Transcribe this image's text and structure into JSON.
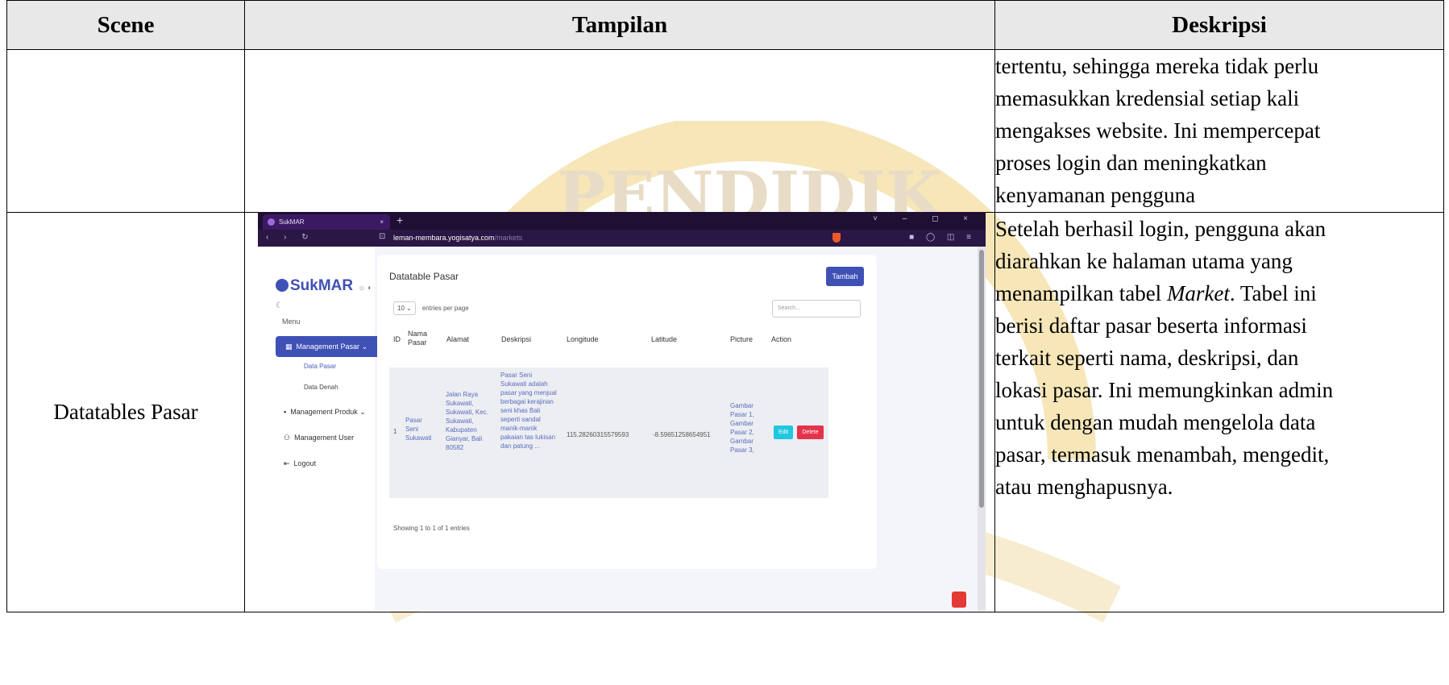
{
  "table": {
    "headers": [
      "Scene",
      "Tampilan",
      "Deskripsi"
    ],
    "row1": {
      "scene": "",
      "description_lines": [
        "tertentu, sehingga mereka tidak perlu",
        "memasukkan kredensial setiap kali",
        "mengakses website. Ini mempercepat",
        "proses login dan meningkatkan",
        "kenyamanan pengguna"
      ]
    },
    "row2": {
      "scene": "Datatables Pasar",
      "description_lines": [
        "Setelah berhasil login, pengguna akan",
        "diarahkan ke halaman utama yang",
        "menampilkan tabel Market. Tabel ini",
        "berisi daftar pasar beserta informasi",
        "terkait seperti nama, deskripsi, dan",
        "lokasi pasar. Ini memungkinkan admin",
        "untuk dengan mudah mengelola data",
        "pasar, termasuk menambah, mengedit,",
        "atau menghapusnya."
      ]
    }
  },
  "screenshot": {
    "tab_title": "SukMAR",
    "url_host": "leman-membara.yogisatya.com",
    "url_path": "/markets",
    "logo": "SukMAR",
    "menu_heading": "Menu",
    "sidebar": {
      "management_pasar": "Management Pasar",
      "data_pasar": "Data Pasar",
      "data_denah": "Data Denah",
      "management_produk": "Management Produk",
      "management_user": "Management User",
      "logout": "Logout"
    },
    "card_title": "Datatable Pasar",
    "add_button": "Tambah",
    "entries_value": "10",
    "entries_label": "entries per page",
    "search_placeholder": "Search...",
    "columns": [
      "ID",
      "Nama Pasar",
      "Alamat",
      "Deskripsi",
      "Longitude",
      "Latitude",
      "Picture",
      "Action"
    ],
    "row": {
      "id": "1",
      "nama": "Pasar Seni Sukawati",
      "alamat": "Jalan Raya Sukawati, Sukawati, Kec. Sukawati, Kabupaten Gianyar, Bali 80582",
      "deskripsi": "Pasar Seni Sukawati adalah pasar yang menjual berbagai kerajinan seni khas Bali seperti sandal manik-manik pakaian tas lukisan dan patung ...",
      "longitude": "115.28260315579593",
      "latitude": "-8.59651258654951",
      "picture": "Gambar Pasar 1, Gambar Pasar 2, Gambar Pasar 3,",
      "edit": "Edit",
      "delete": "Delete"
    },
    "showing": "Showing 1 to 1 of 1 entries"
  }
}
